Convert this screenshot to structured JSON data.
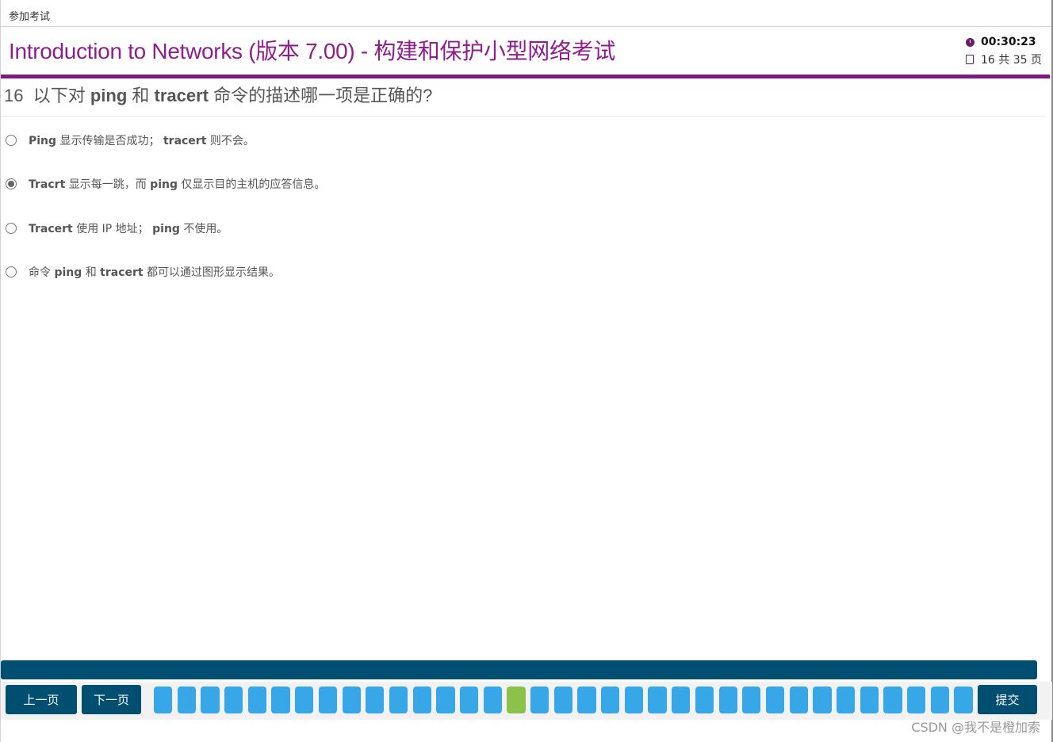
{
  "topbar": {
    "label": "参加考试"
  },
  "header": {
    "title": "Introduction to Networks (版本 7.00) - 构建和保护小型网络考试",
    "timer": "00:30:23",
    "page_info": "16 共 35 页"
  },
  "question": {
    "number": "16",
    "text_parts": [
      "以下对 ",
      "ping",
      " 和 ",
      "tracert",
      " 命令的描述哪一项是正确的?"
    ]
  },
  "options": [
    {
      "bold1": "Ping",
      "t1": " 显示传输是否成功； ",
      "bold2": "tracert",
      "t2": " 则不会。",
      "selected": false
    },
    {
      "bold1": "Tracrt",
      "t1": " 显示每一跳，而 ",
      "bold2": "ping",
      "t2": " 仅显示目的主机的应答信息。",
      "selected": true
    },
    {
      "bold1": "Tracert",
      "t1": " 使用 IP 地址； ",
      "bold2": "ping",
      "t2": " 不使用。",
      "selected": false
    },
    {
      "t0": "命令 ",
      "bold1": "ping",
      "t1": " 和 ",
      "bold2": "tracert",
      "t2": " 都可以通过图形显示结果。",
      "selected": false
    }
  ],
  "nav": {
    "prev_label": "上一页",
    "next_label": "下一页",
    "submit_label": "提交",
    "total_questions": 35,
    "current_question": 16
  },
  "watermark": "CSDN @我不是橙加索",
  "colors": {
    "accent": "#8e1e8e",
    "nav_bg": "#004e70",
    "square": "#37a7e8",
    "current_square": "#8bc34a"
  }
}
